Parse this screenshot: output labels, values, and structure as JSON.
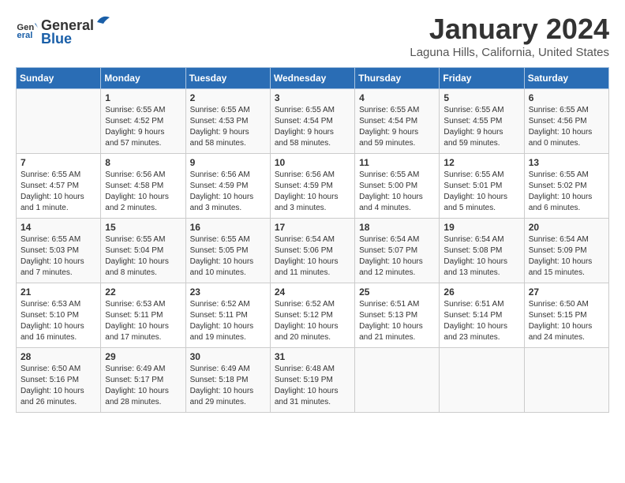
{
  "logo": {
    "general": "General",
    "blue": "Blue"
  },
  "title": "January 2024",
  "subtitle": "Laguna Hills, California, United States",
  "days_header": [
    "Sunday",
    "Monday",
    "Tuesday",
    "Wednesday",
    "Thursday",
    "Friday",
    "Saturday"
  ],
  "weeks": [
    [
      {
        "day": "",
        "info": ""
      },
      {
        "day": "1",
        "info": "Sunrise: 6:55 AM\nSunset: 4:52 PM\nDaylight: 9 hours\nand 57 minutes."
      },
      {
        "day": "2",
        "info": "Sunrise: 6:55 AM\nSunset: 4:53 PM\nDaylight: 9 hours\nand 58 minutes."
      },
      {
        "day": "3",
        "info": "Sunrise: 6:55 AM\nSunset: 4:54 PM\nDaylight: 9 hours\nand 58 minutes."
      },
      {
        "day": "4",
        "info": "Sunrise: 6:55 AM\nSunset: 4:54 PM\nDaylight: 9 hours\nand 59 minutes."
      },
      {
        "day": "5",
        "info": "Sunrise: 6:55 AM\nSunset: 4:55 PM\nDaylight: 9 hours\nand 59 minutes."
      },
      {
        "day": "6",
        "info": "Sunrise: 6:55 AM\nSunset: 4:56 PM\nDaylight: 10 hours\nand 0 minutes."
      }
    ],
    [
      {
        "day": "7",
        "info": "Sunrise: 6:55 AM\nSunset: 4:57 PM\nDaylight: 10 hours\nand 1 minute."
      },
      {
        "day": "8",
        "info": "Sunrise: 6:56 AM\nSunset: 4:58 PM\nDaylight: 10 hours\nand 2 minutes."
      },
      {
        "day": "9",
        "info": "Sunrise: 6:56 AM\nSunset: 4:59 PM\nDaylight: 10 hours\nand 3 minutes."
      },
      {
        "day": "10",
        "info": "Sunrise: 6:56 AM\nSunset: 4:59 PM\nDaylight: 10 hours\nand 3 minutes."
      },
      {
        "day": "11",
        "info": "Sunrise: 6:55 AM\nSunset: 5:00 PM\nDaylight: 10 hours\nand 4 minutes."
      },
      {
        "day": "12",
        "info": "Sunrise: 6:55 AM\nSunset: 5:01 PM\nDaylight: 10 hours\nand 5 minutes."
      },
      {
        "day": "13",
        "info": "Sunrise: 6:55 AM\nSunset: 5:02 PM\nDaylight: 10 hours\nand 6 minutes."
      }
    ],
    [
      {
        "day": "14",
        "info": "Sunrise: 6:55 AM\nSunset: 5:03 PM\nDaylight: 10 hours\nand 7 minutes."
      },
      {
        "day": "15",
        "info": "Sunrise: 6:55 AM\nSunset: 5:04 PM\nDaylight: 10 hours\nand 8 minutes."
      },
      {
        "day": "16",
        "info": "Sunrise: 6:55 AM\nSunset: 5:05 PM\nDaylight: 10 hours\nand 10 minutes."
      },
      {
        "day": "17",
        "info": "Sunrise: 6:54 AM\nSunset: 5:06 PM\nDaylight: 10 hours\nand 11 minutes."
      },
      {
        "day": "18",
        "info": "Sunrise: 6:54 AM\nSunset: 5:07 PM\nDaylight: 10 hours\nand 12 minutes."
      },
      {
        "day": "19",
        "info": "Sunrise: 6:54 AM\nSunset: 5:08 PM\nDaylight: 10 hours\nand 13 minutes."
      },
      {
        "day": "20",
        "info": "Sunrise: 6:54 AM\nSunset: 5:09 PM\nDaylight: 10 hours\nand 15 minutes."
      }
    ],
    [
      {
        "day": "21",
        "info": "Sunrise: 6:53 AM\nSunset: 5:10 PM\nDaylight: 10 hours\nand 16 minutes."
      },
      {
        "day": "22",
        "info": "Sunrise: 6:53 AM\nSunset: 5:11 PM\nDaylight: 10 hours\nand 17 minutes."
      },
      {
        "day": "23",
        "info": "Sunrise: 6:52 AM\nSunset: 5:11 PM\nDaylight: 10 hours\nand 19 minutes."
      },
      {
        "day": "24",
        "info": "Sunrise: 6:52 AM\nSunset: 5:12 PM\nDaylight: 10 hours\nand 20 minutes."
      },
      {
        "day": "25",
        "info": "Sunrise: 6:51 AM\nSunset: 5:13 PM\nDaylight: 10 hours\nand 21 minutes."
      },
      {
        "day": "26",
        "info": "Sunrise: 6:51 AM\nSunset: 5:14 PM\nDaylight: 10 hours\nand 23 minutes."
      },
      {
        "day": "27",
        "info": "Sunrise: 6:50 AM\nSunset: 5:15 PM\nDaylight: 10 hours\nand 24 minutes."
      }
    ],
    [
      {
        "day": "28",
        "info": "Sunrise: 6:50 AM\nSunset: 5:16 PM\nDaylight: 10 hours\nand 26 minutes."
      },
      {
        "day": "29",
        "info": "Sunrise: 6:49 AM\nSunset: 5:17 PM\nDaylight: 10 hours\nand 28 minutes."
      },
      {
        "day": "30",
        "info": "Sunrise: 6:49 AM\nSunset: 5:18 PM\nDaylight: 10 hours\nand 29 minutes."
      },
      {
        "day": "31",
        "info": "Sunrise: 6:48 AM\nSunset: 5:19 PM\nDaylight: 10 hours\nand 31 minutes."
      },
      {
        "day": "",
        "info": ""
      },
      {
        "day": "",
        "info": ""
      },
      {
        "day": "",
        "info": ""
      }
    ]
  ]
}
